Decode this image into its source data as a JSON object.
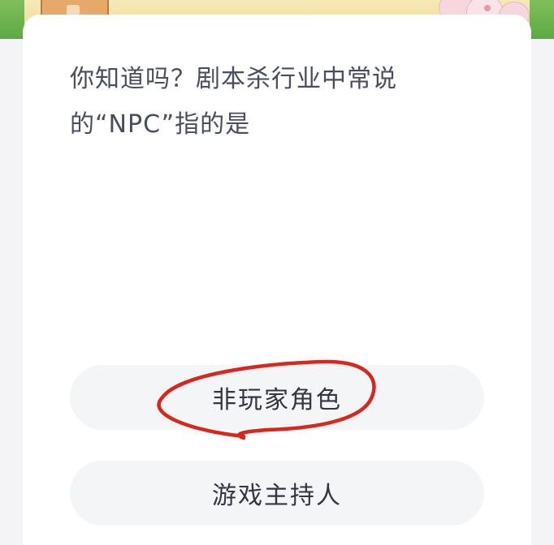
{
  "question": {
    "text": "你知道吗？剧本杀行业中常说的“NPC”指的是"
  },
  "options": [
    {
      "label": "非玩家角色",
      "highlighted": true
    },
    {
      "label": "游戏主持人",
      "highlighted": false
    }
  ],
  "colors": {
    "page_background": "#f4f4f6",
    "card_background": "#ffffff",
    "option_background": "#f4f5f7",
    "question_text": "#4a4e5c",
    "annotation_red": "#d8281e"
  },
  "icons": {
    "banner": "cartoon-illustration-icon",
    "annotation": "hand-drawn-circle-icon"
  }
}
